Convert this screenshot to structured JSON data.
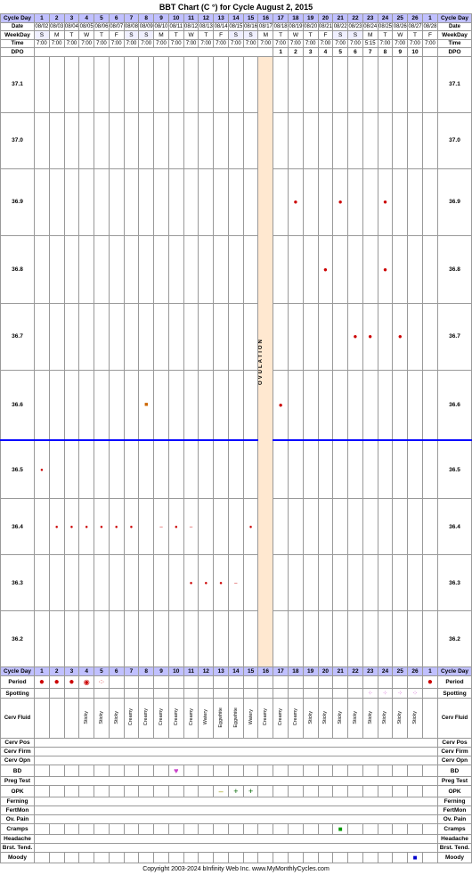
{
  "title": "BBT Chart (C °) for Cycle August 2, 2015",
  "footer": "Copyright 2003-2024 bInfinity Web Inc.   www.MyMonthlyCycles.com",
  "header": {
    "cycle_day_label": "Cycle Day",
    "date_label": "Date",
    "weekday_label": "WeekDay",
    "time_label": "Time",
    "dpo_label": "DPO"
  },
  "cycle_days": [
    1,
    2,
    3,
    4,
    5,
    6,
    7,
    8,
    9,
    10,
    11,
    12,
    13,
    14,
    15,
    16,
    17,
    18,
    19,
    20,
    21,
    22,
    23,
    24,
    25,
    26,
    1
  ],
  "dates": [
    "08/02",
    "08/03",
    "08/04",
    "08/05",
    "08/06",
    "08/07",
    "08/08",
    "08/09",
    "08/10",
    "08/11",
    "08/12",
    "08/13",
    "08/14",
    "08/15",
    "08/16",
    "08/17",
    "08/18",
    "08/19",
    "08/20",
    "08/21",
    "08/22",
    "08/23",
    "08/24",
    "08/25",
    "08/26",
    "08/27",
    "08/28"
  ],
  "weekdays": [
    "S",
    "M",
    "T",
    "W",
    "T",
    "F",
    "S",
    "S",
    "M",
    "T",
    "W",
    "T",
    "F",
    "S",
    "S",
    "M",
    "T",
    "W",
    "T",
    "F",
    "S",
    "S",
    "M",
    "T",
    "W",
    "T",
    "F"
  ],
  "times": [
    "7:00",
    "7:00",
    "7:00",
    "7:00",
    "7:00",
    "7:00",
    "7:00",
    "7:00",
    "7:00",
    "7:00",
    "7:00",
    "7:00",
    "7:00",
    "7:00",
    "7:00",
    "7:00",
    "7:00",
    "7:00",
    "7:00",
    "7:00",
    "7:00",
    "7:00",
    "5:15",
    "7:00",
    "7:00",
    "7:00",
    "7:00"
  ],
  "dpo": [
    "",
    "",
    "",
    "",
    "",
    "",
    "",
    "",
    "",
    "",
    "",
    "",
    "",
    "",
    "",
    "",
    "1",
    "2",
    "3",
    "4",
    "5",
    "6",
    "7",
    "8",
    "9",
    "10",
    ""
  ],
  "temp_labels": [
    "37.1",
    "37.0",
    "36.9",
    "36.8",
    "36.7",
    "36.6",
    "36.5",
    "36.4",
    "36.3",
    "36.2"
  ],
  "temperatures": {
    "1": null,
    "2": 36.5,
    "3": 36.35,
    "4": 36.4,
    "5": 36.45,
    "6": 36.4,
    "7": 36.4,
    "8": 36.4,
    "9": null,
    "10": 36.4,
    "11": null,
    "12": 36.3,
    "13": 36.3,
    "14": 36.35,
    "15": 36.4,
    "16": 36.6,
    "17": null,
    "18": 36.9,
    "19": 36.85,
    "20": 36.75,
    "21": 36.85,
    "22": 36.65,
    "23": 36.7,
    "24": 36.85,
    "25": 36.7,
    "26": null,
    "27": null
  },
  "period": {
    "1": "filled",
    "2": "filled",
    "3": "filled",
    "4": "open",
    "5": "dotted"
  },
  "spotting": {
    "23": "dots",
    "24": "dots",
    "25": "dots",
    "26": "dots"
  },
  "cerv_fluid": {
    "4": "Sticky",
    "5": "Sticky",
    "6": "Sticky",
    "7": "Creamy",
    "8": "Creamy",
    "9": "Creamy",
    "10": "Creamy",
    "11": "Creamy",
    "12": "Watery",
    "13": "Eggwhite",
    "14": "Eggwhite",
    "15": "Watery",
    "16": "Creamy",
    "17": "Creamy",
    "18": "Creamy",
    "19": "Sticky",
    "20": "Sticky",
    "21": "Sticky",
    "22": "Sticky",
    "23": "Sticky",
    "24": "Sticky",
    "25": "Sticky",
    "26": "Sticky"
  },
  "bd": {
    "10": "heart"
  },
  "opk": {
    "13": "minus",
    "14": "plus",
    "15": "plus"
  },
  "cramps": {
    "21": "green_square"
  }
}
